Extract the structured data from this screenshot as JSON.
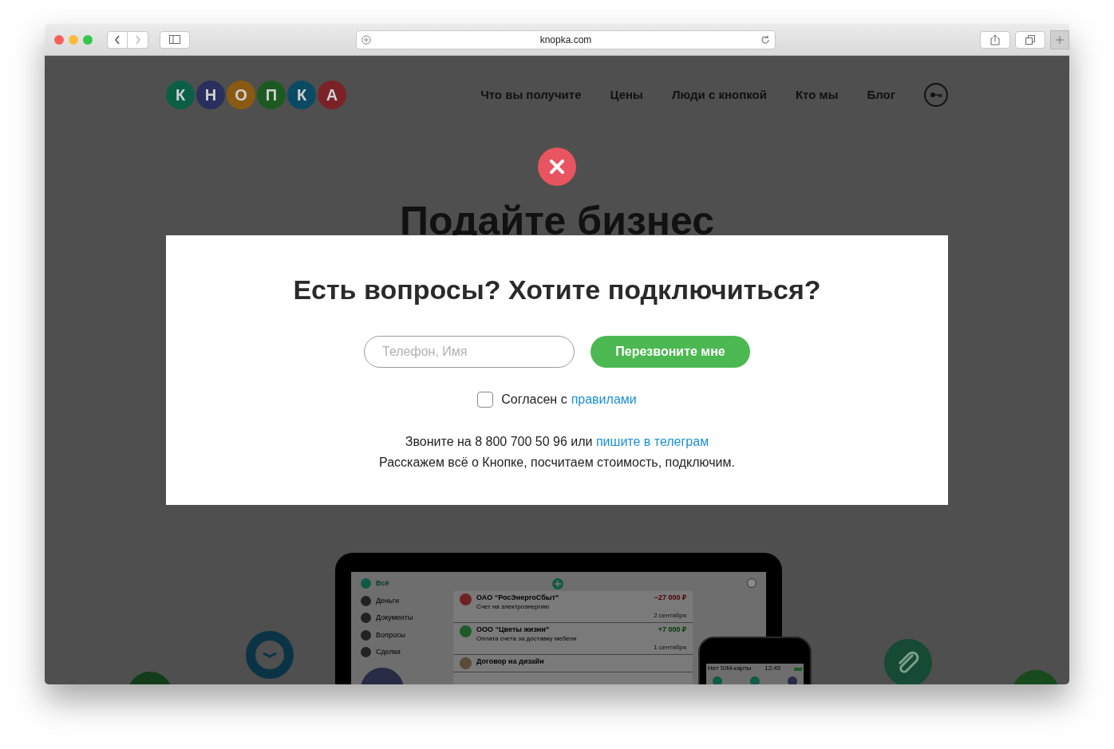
{
  "browser": {
    "url": "knopka.com"
  },
  "logo": [
    {
      "letter": "К",
      "color": "#0b5f45"
    },
    {
      "letter": "Н",
      "color": "#2a2f5e"
    },
    {
      "letter": "О",
      "color": "#8a5a12"
    },
    {
      "letter": "П",
      "color": "#1c5a22"
    },
    {
      "letter": "К",
      "color": "#0c4a63"
    },
    {
      "letter": "А",
      "color": "#7a2228"
    }
  ],
  "nav": [
    "Что вы получите",
    "Цены",
    "Люди с кнопкой",
    "Кто мы",
    "Блог"
  ],
  "hero": {
    "heading": "Подайте бизнес"
  },
  "modal": {
    "title": "Есть вопросы? Хотите подключиться?",
    "phone_placeholder": "Телефон, Имя",
    "submit": "Перезвоните мне",
    "consent": {
      "checked": false,
      "text": "Согласен с",
      "link": "правилами"
    },
    "contact": {
      "text": "Звоните на 8 800 700 50 96 или",
      "link": "пишите в телеграм"
    },
    "note": "Расскажем всё о Кнопке, посчитаем стоимость, подключим."
  },
  "mockup": {
    "sidebar": [
      {
        "label": "Всё",
        "selected": true
      },
      {
        "label": "Деньги",
        "selected": false
      },
      {
        "label": "Документы",
        "selected": false
      },
      {
        "label": "Вопросы",
        "selected": false
      },
      {
        "label": "Сделки",
        "selected": false
      }
    ],
    "feed": [
      {
        "kind": "expense",
        "title": "ОАО “РосЭнергоСбыт”",
        "subtitle": "Счет на электроэнергию",
        "amount": "−27 000 ₽",
        "date": "2 сентября"
      },
      {
        "kind": "income",
        "title": "ООО “Цветы жизни”",
        "subtitle": "Оплата счета за доставку мебели",
        "amount": "+7 000 ₽",
        "date": "1 сентября"
      },
      {
        "kind": "person",
        "title": "Договор на дизайн"
      }
    ],
    "phone": {
      "carrier": "Нет SIM-карты",
      "time": "12:45"
    }
  }
}
